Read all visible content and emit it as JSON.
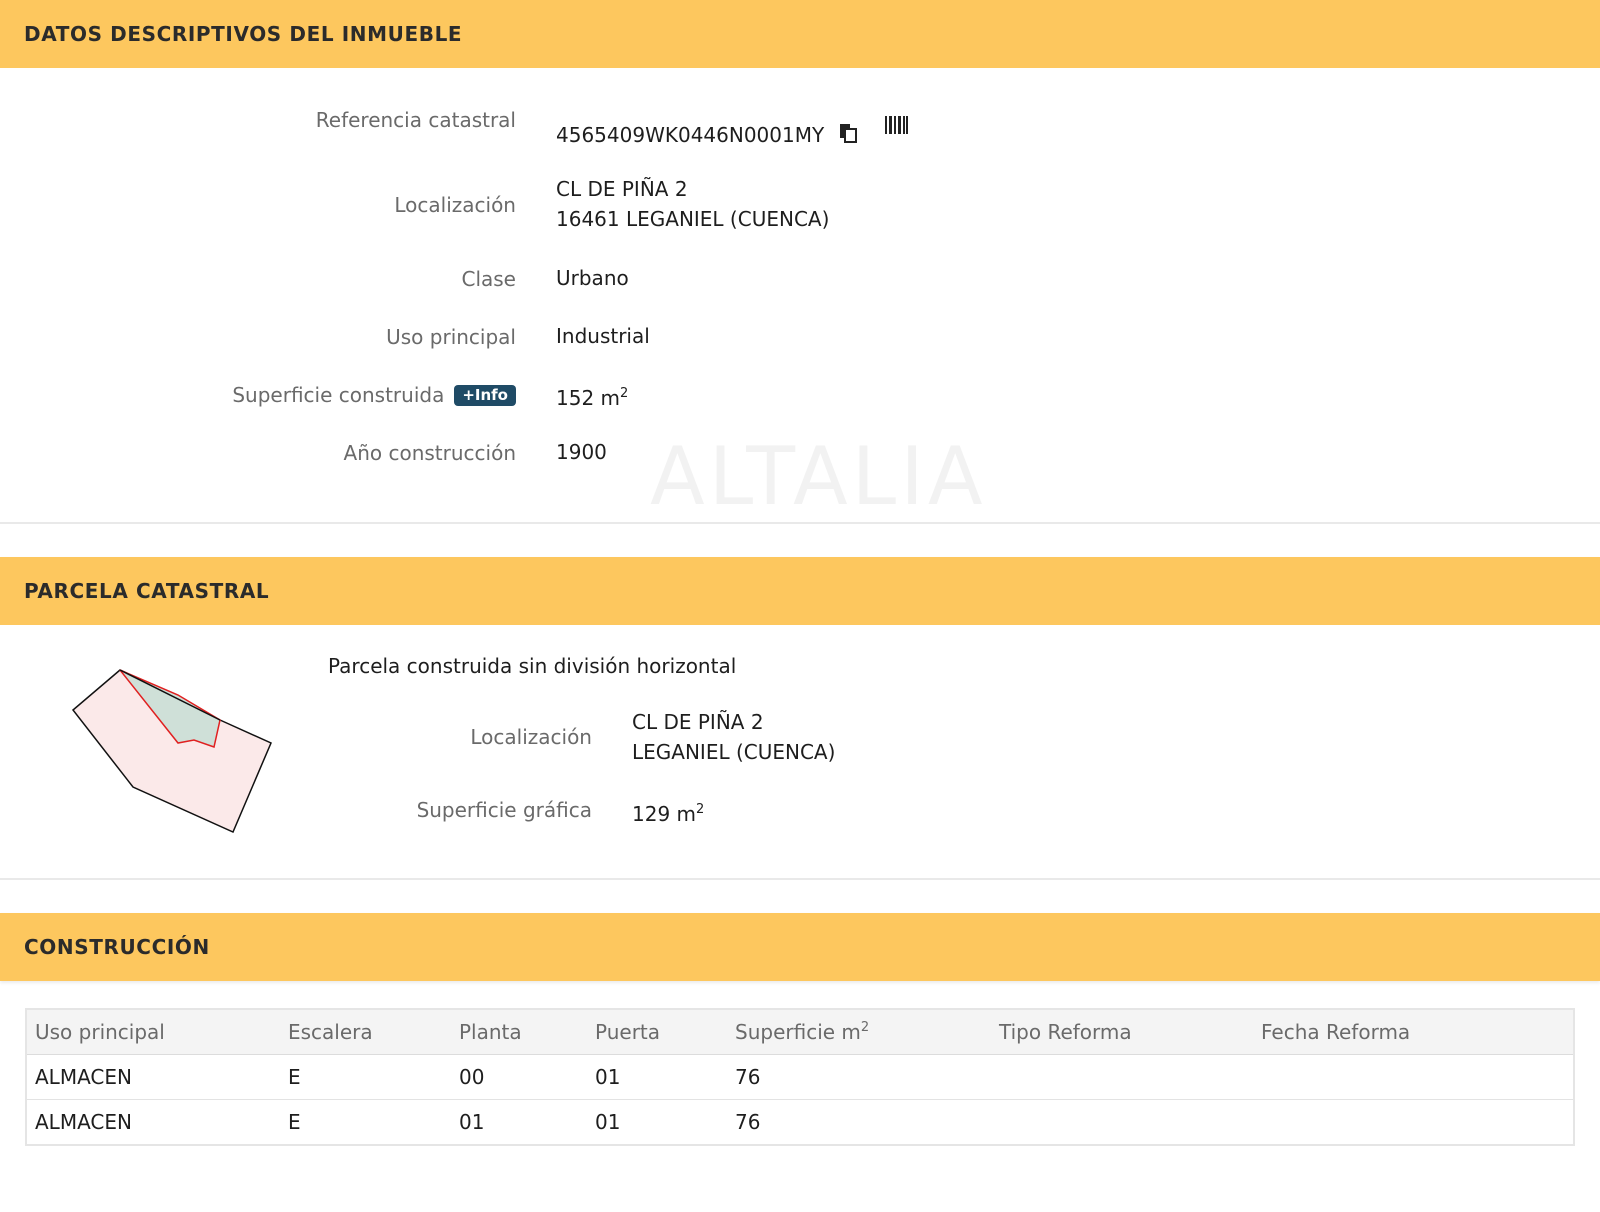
{
  "datos": {
    "title": "DATOS DESCRIPTIVOS DEL INMUEBLE",
    "ref_label": "Referencia catastral",
    "ref_value": "4565409WK0446N0001MY",
    "loc_label": "Localización",
    "loc_line1": "CL DE PIÑA 2",
    "loc_line2": "16461 LEGANIEL (CUENCA)",
    "clase_label": "Clase",
    "clase_value": "Urbano",
    "uso_label": "Uso principal",
    "uso_value": "Industrial",
    "sup_label": "Superficie construida",
    "info_badge": "+Info",
    "sup_value": "152 m",
    "sup_exp": "2",
    "anio_label": "Año construcción",
    "anio_value": "1900",
    "watermark": "ALTALIA"
  },
  "parcela": {
    "title": "PARCELA CATASTRAL",
    "subtitle": "Parcela construida sin división horizontal",
    "loc_label": "Localización",
    "loc_line1": "CL DE PIÑA 2",
    "loc_line2": "LEGANIEL (CUENCA)",
    "sup_label": "Superficie gráfica",
    "sup_value": "129 m",
    "sup_exp": "2"
  },
  "construccion": {
    "title": "CONSTRUCCIÓN",
    "headers": [
      "Uso principal",
      "Escalera",
      "Planta",
      "Puerta",
      "Superficie m",
      "Tipo Reforma",
      "Fecha Reforma"
    ],
    "header_sup_exp": "2",
    "rows": [
      [
        "ALMACEN",
        "E",
        "00",
        "01",
        "76",
        "",
        ""
      ],
      [
        "ALMACEN",
        "E",
        "01",
        "01",
        "76",
        "",
        ""
      ]
    ]
  },
  "colors": {
    "header_bg": "#fdc75e",
    "badge_bg": "#1f4b66",
    "parcel_fill": "#fbe9e9",
    "building_fill": "#cfe0d8",
    "building_stroke": "#e02020"
  }
}
